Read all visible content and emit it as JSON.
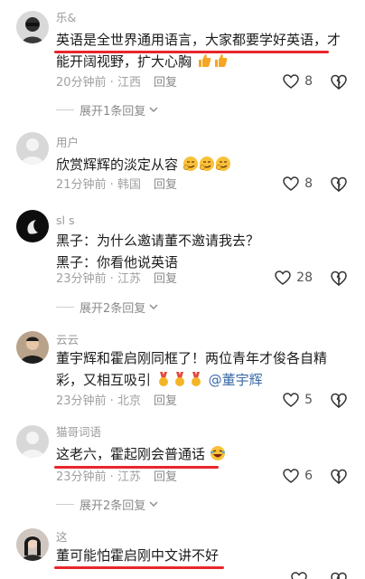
{
  "comments": [
    {
      "username": "乐&",
      "lines": [
        "英语是全世界通用语言，大家都要学好英语，才",
        "能开阔视野，扩大心胸"
      ],
      "time": "20分钟前",
      "location": "江西",
      "reply_label": "回复",
      "likes": "8",
      "expand": "展开1条回复"
    },
    {
      "username": "用户",
      "lines": [
        "欣赏辉辉的淡定从容"
      ],
      "time": "21分钟前",
      "location": "韩国",
      "reply_label": "回复",
      "likes": "8"
    },
    {
      "username": "sl  s",
      "lines": [
        "黑子：为什么邀请董不邀请我去？",
        "黑子：你看他说英语"
      ],
      "time": "23分钟前",
      "location": "江苏",
      "reply_label": "回复",
      "likes": "28",
      "expand": "展开2条回复"
    },
    {
      "username": "云云",
      "lines": [
        "董宇辉和霍启刚同框了！两位青年才俊各自精",
        "彩，又相互吸引",
        "@董宇辉"
      ],
      "time": "23分钟前",
      "location": "北京",
      "reply_label": "回复",
      "likes": "5"
    },
    {
      "username": "猫哥词语",
      "lines": [
        "这老六，霍起刚会普通话"
      ],
      "time": "23分钟前",
      "location": "江苏",
      "reply_label": "回复",
      "likes": "6",
      "expand": "展开2条回复"
    },
    {
      "username": "这",
      "lines": [
        "董可能怕霍启刚中文讲不好"
      ],
      "likes": ""
    }
  ],
  "colors": {
    "underline": "#e8262c",
    "mention": "#3b6aa6"
  }
}
